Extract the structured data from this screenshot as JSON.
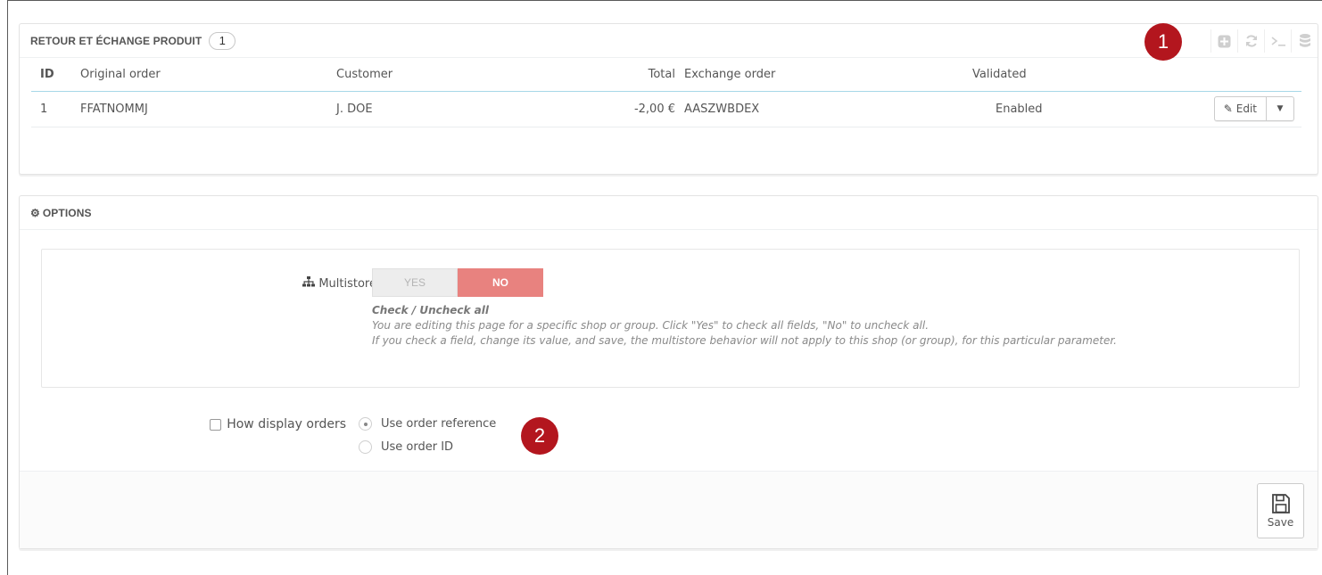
{
  "list_panel": {
    "title": "RETOUR ET ÉCHANGE PRODUIT",
    "count": "1",
    "toolbar": {
      "icons": [
        "add-icon",
        "refresh-icon",
        "terminal-icon",
        "database-icon"
      ]
    },
    "columns": {
      "id": "ID",
      "original_order": "Original order",
      "customer": "Customer",
      "total": "Total",
      "exchange_order": "Exchange order",
      "validated": "Validated"
    },
    "rows": [
      {
        "id": "1",
        "original_order": "FFATNOMMJ",
        "customer": "J. DOE",
        "total": "-2,00 €",
        "exchange_order": "AASZWBDEX",
        "validated": "Enabled",
        "edit_label": "Edit"
      }
    ]
  },
  "options_panel": {
    "title": "OPTIONS",
    "multistore": {
      "label": "Multistore",
      "yes": "YES",
      "no": "NO",
      "selected": "NO",
      "help_title": "Check / Uncheck all",
      "help_line1": "You are editing this page for a specific shop or group. Click \"Yes\" to check all fields, \"No\" to uncheck all.",
      "help_line2": "If you check a field, change its value, and save, the multistore behavior will not apply to this shop (or group), for this particular parameter."
    },
    "display_orders": {
      "label": "How display orders",
      "options": [
        "Use order reference",
        "Use order ID"
      ],
      "selected": "Use order reference"
    },
    "save_label": "Save"
  },
  "callouts": {
    "one": "1",
    "two": "2"
  },
  "colors": {
    "callout": "#b3161e",
    "switch_no": "#e8827f",
    "header_underline": "#a7d7e8"
  }
}
